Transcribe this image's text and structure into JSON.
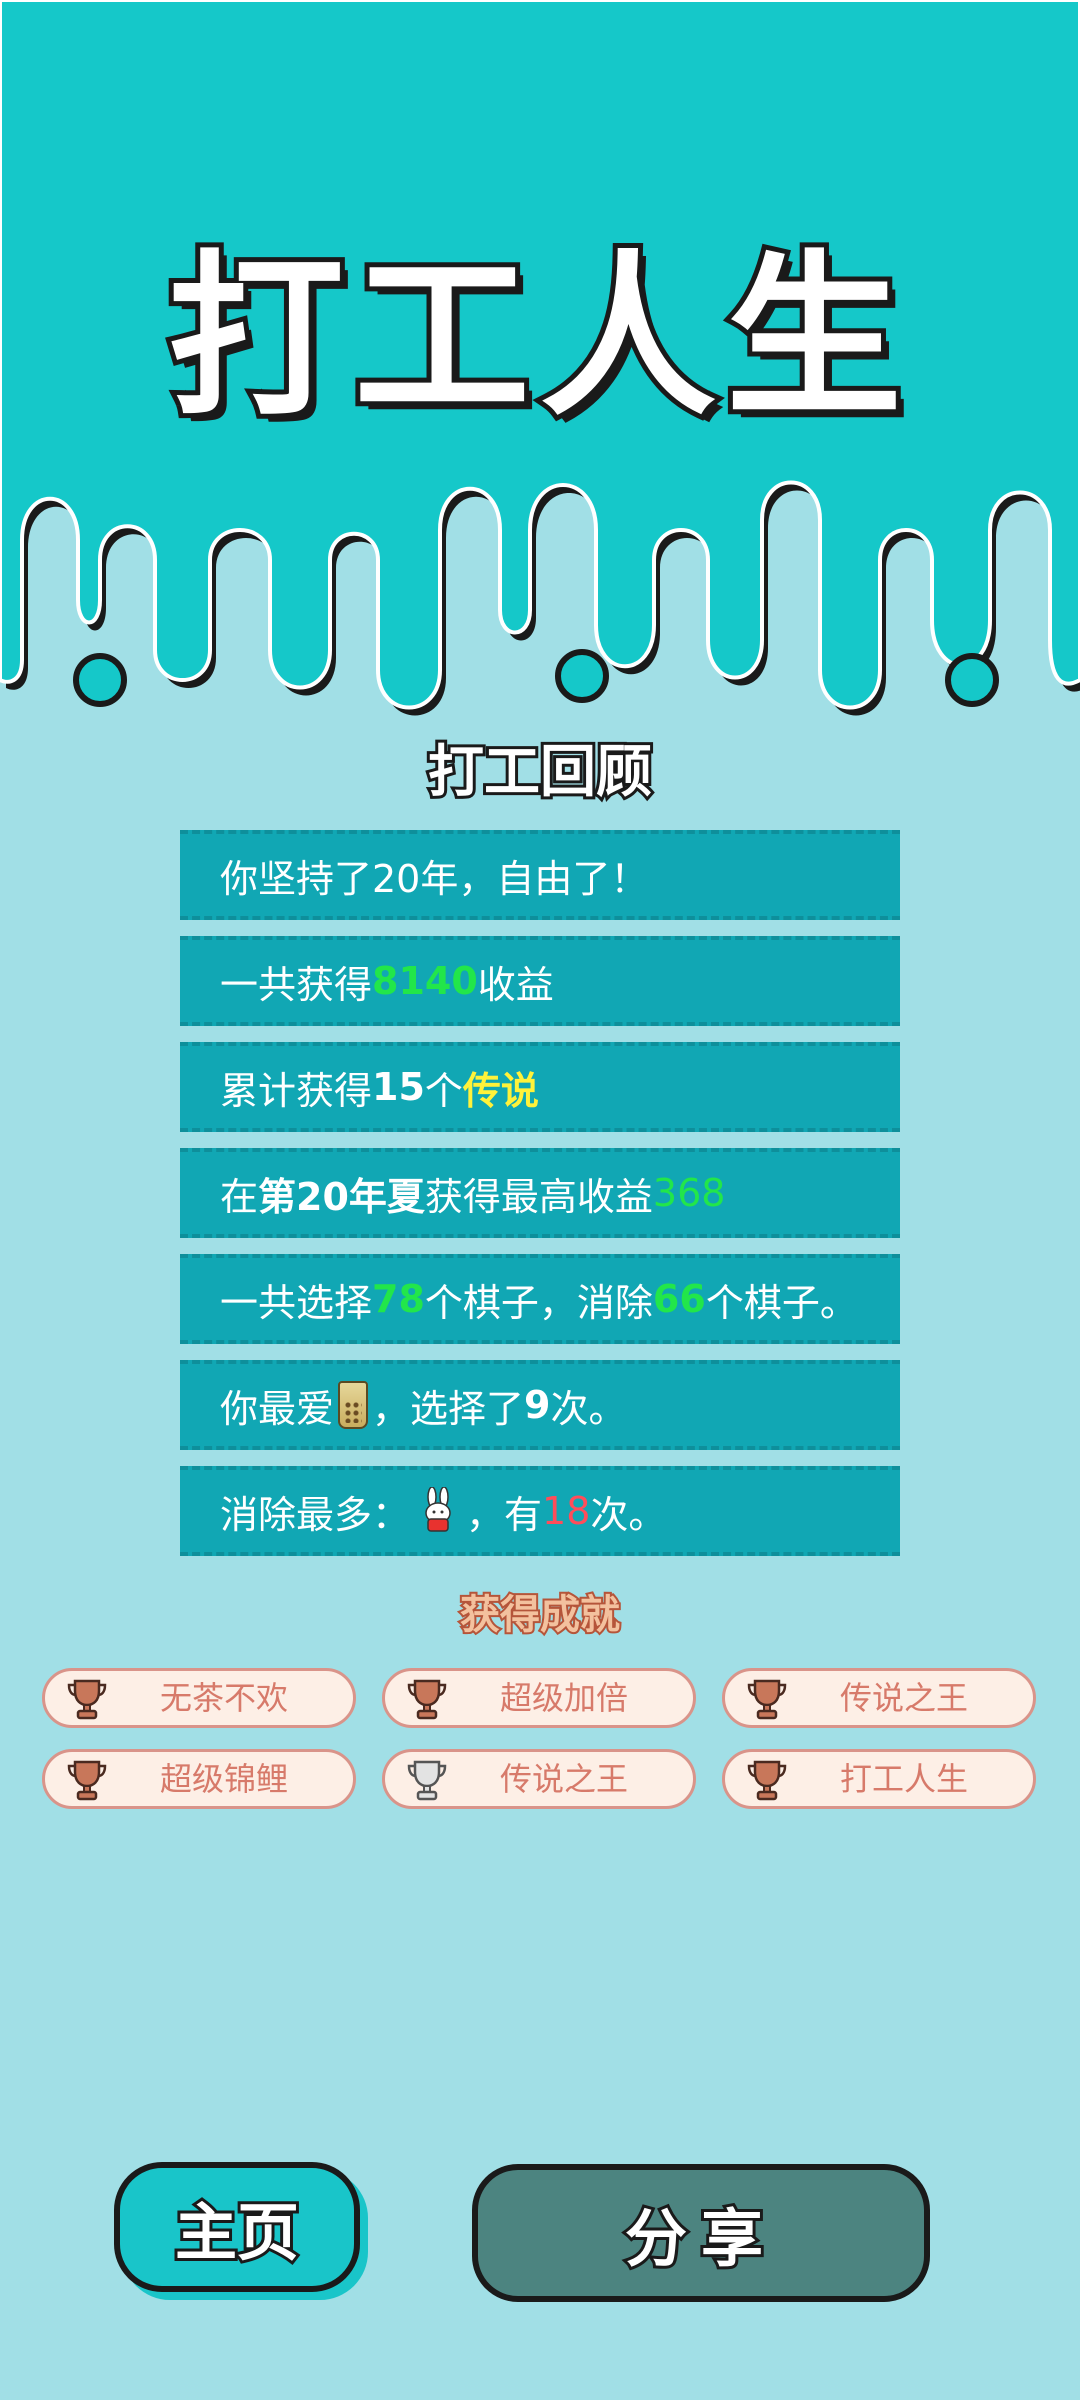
{
  "game": {
    "title": "打工人生",
    "colors": {
      "top_band": "#15c8c9",
      "background": "#a1dfe6",
      "row": "#11a7b4",
      "highlight_green": "#22e64a",
      "highlight_yellow": "#fff23a",
      "highlight_red": "#ff4d5a"
    }
  },
  "review": {
    "heading": "打工回顾",
    "rows": [
      {
        "a": "你坚持了20年，自由了！"
      },
      {
        "a": "一共获得",
        "num": "8140",
        "b": "收益"
      },
      {
        "a": "累计获得",
        "num": "15",
        "mid": "个",
        "tag": "传说"
      },
      {
        "a": "在 ",
        "season": "第20年夏",
        "b": " 获得最高收益",
        "num": "368"
      },
      {
        "a": "一共选择",
        "num1": "78",
        "b": "个棋子，消除",
        "num2": "66",
        "c": "个棋子。"
      },
      {
        "a": "你最爱",
        "icon": "milk-tea-icon",
        "b": "，选择了",
        "num": "9",
        "c": "次。"
      },
      {
        "a": "消除最多：",
        "icon": "rabbit-icon",
        "b": "，有",
        "num": "18",
        "c": "次。"
      }
    ]
  },
  "achievements": {
    "heading": "获得成就",
    "items": [
      {
        "label": "无茶不欢",
        "icon": "bronze-trophy-icon"
      },
      {
        "label": "超级加倍",
        "icon": "bronze-trophy-icon"
      },
      {
        "label": "传说之王",
        "icon": "bronze-trophy-icon"
      },
      {
        "label": "超级锦鲤",
        "icon": "bronze-trophy-icon"
      },
      {
        "label": "传说之王",
        "icon": "silver-trophy-icon"
      },
      {
        "label": "打工人生",
        "icon": "bronze-trophy-icon"
      }
    ]
  },
  "buttons": {
    "home": "主页",
    "share": "分享"
  }
}
